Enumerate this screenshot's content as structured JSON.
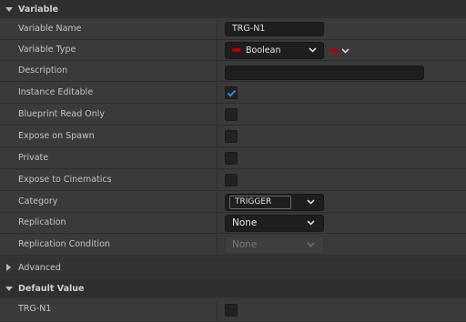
{
  "sections": {
    "variable": "Variable",
    "advanced": "Advanced",
    "default_value": "Default Value"
  },
  "rows": {
    "variable_name": {
      "label": "Variable Name",
      "value": "TRG-N1"
    },
    "variable_type": {
      "label": "Variable Type",
      "value": "Boolean",
      "pin_color": "#b30000"
    },
    "description": {
      "label": "Description",
      "value": ""
    },
    "instance_editable": {
      "label": "Instance Editable",
      "checked": true
    },
    "blueprint_read_only": {
      "label": "Blueprint Read Only",
      "checked": false
    },
    "expose_on_spawn": {
      "label": "Expose on Spawn",
      "checked": false
    },
    "private": {
      "label": "Private",
      "checked": false
    },
    "expose_to_cinematics": {
      "label": "Expose to Cinematics",
      "checked": false
    },
    "category": {
      "label": "Category",
      "value": "TRIGGER"
    },
    "replication": {
      "label": "Replication",
      "value": "None"
    },
    "replication_condition": {
      "label": "Replication Condition",
      "value": "None"
    },
    "default_trg": {
      "label": "TRG-N1",
      "checked": false
    }
  },
  "colors": {
    "accent": "#2a8ad6",
    "pin_bool": "#b30000"
  }
}
